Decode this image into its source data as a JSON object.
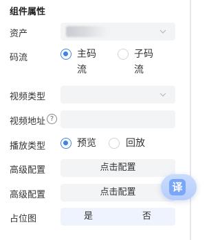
{
  "panel": {
    "title": "组件属性"
  },
  "asset": {
    "label": "资产",
    "value": ""
  },
  "stream": {
    "label": "码流",
    "options": [
      {
        "line1": "主码",
        "line2": "流",
        "selected": true
      },
      {
        "line1": "子码",
        "line2": "流",
        "selected": false
      }
    ]
  },
  "video_type": {
    "label": "视频类型",
    "value": ""
  },
  "video_url": {
    "label": "视频地址",
    "help": "?",
    "value": ""
  },
  "play_type": {
    "label": "播放类型",
    "options": [
      {
        "label": "预览",
        "selected": true
      },
      {
        "label": "回放",
        "selected": false
      }
    ]
  },
  "advanced_1": {
    "label": "高级配置",
    "button": "点击配置"
  },
  "advanced_2": {
    "label": "高级配置",
    "button": "点击配置"
  },
  "placeholder_map": {
    "label": "占位图",
    "yes": "是",
    "no": "否"
  },
  "translate_fab": {
    "glyph": "译"
  },
  "colors": {
    "accent": "#3c82f6",
    "field_bg": "#f3f4f6",
    "segment_bg": "#eef3fd"
  }
}
